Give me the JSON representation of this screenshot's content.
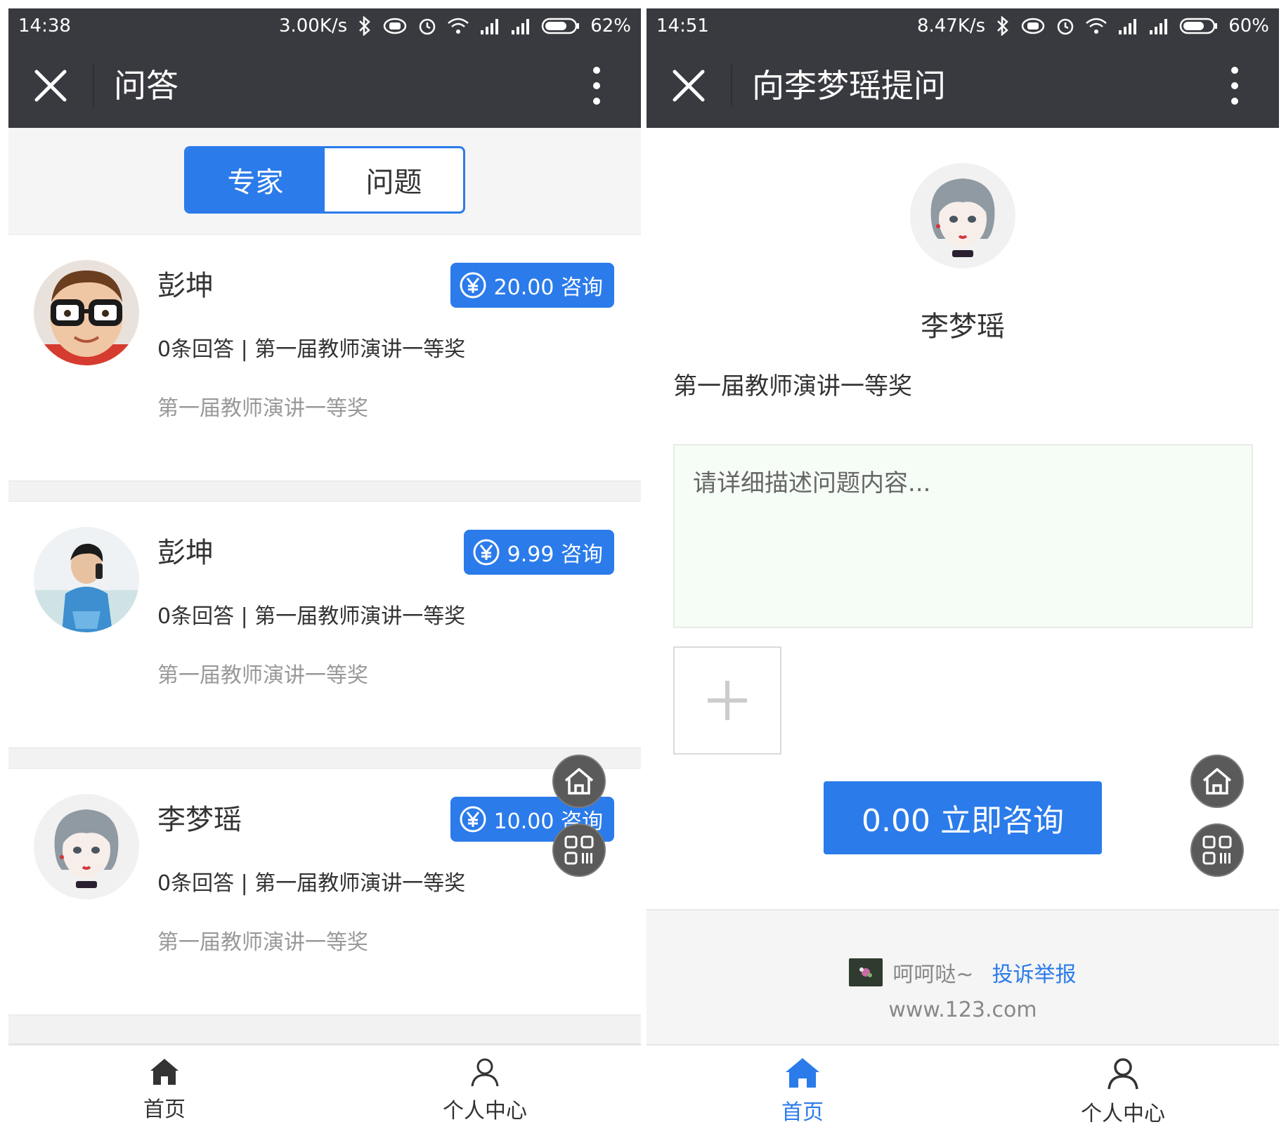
{
  "colors": {
    "accent": "#2b7bea",
    "topbar": "#393a3f",
    "page_bg": "#f5f5f5",
    "muted_text": "#999999"
  },
  "left_screen": {
    "status_bar": {
      "time": "14:38",
      "speed": "3.00K/s",
      "battery": "62%"
    },
    "title_bar": {
      "title": "问答",
      "close_icon": "close-icon",
      "more_icon": "more-vertical-icon"
    },
    "tabs": [
      {
        "label": "专家",
        "active": true
      },
      {
        "label": "问题",
        "active": false
      }
    ],
    "experts": [
      {
        "name": "彭坤",
        "price_label": "20.00 咨询",
        "meta": "0条回答 | 第一届教师演讲一等奖",
        "desc": "第一届教师演讲一等奖",
        "avatar": "avatar-boy-glasses"
      },
      {
        "name": "彭坤",
        "price_label": "9.99 咨询",
        "meta": "0条回答 | 第一届教师演讲一等奖",
        "desc": "第一届教师演讲一等奖",
        "avatar": "avatar-boy-phone"
      },
      {
        "name": "李梦瑶",
        "price_label": "10.00 咨询",
        "meta": "0条回答 | 第一届教师演讲一等奖",
        "desc": "第一届教师演讲一等奖",
        "avatar": "avatar-girl-illustration"
      }
    ],
    "floating_buttons": [
      "home-icon",
      "qrcode-icon"
    ],
    "bottom_nav": [
      {
        "label": "首页",
        "icon": "home-icon",
        "active": false
      },
      {
        "label": "个人中心",
        "icon": "user-icon",
        "active": false
      }
    ]
  },
  "right_screen": {
    "status_bar": {
      "time": "14:51",
      "speed": "8.47K/s",
      "battery": "60%"
    },
    "title_bar": {
      "title": "向李梦瑶提问",
      "close_icon": "close-icon",
      "more_icon": "more-vertical-icon"
    },
    "expert": {
      "name": "李梦瑶",
      "title": "第一届教师演讲一等奖",
      "avatar": "avatar-girl-illustration"
    },
    "question": {
      "placeholder": "请详细描述问题内容...",
      "value": ""
    },
    "upload": {
      "icon": "plus-icon"
    },
    "submit_label": "0.00 立即咨询",
    "floating_buttons": [
      "home-icon",
      "qrcode-icon"
    ],
    "footer": {
      "site_name": "呵呵哒~",
      "report_link": "投诉举报",
      "url": "www.123.com"
    },
    "bottom_nav": [
      {
        "label": "首页",
        "icon": "home-icon",
        "active": true
      },
      {
        "label": "个人中心",
        "icon": "user-icon",
        "active": false
      }
    ]
  }
}
